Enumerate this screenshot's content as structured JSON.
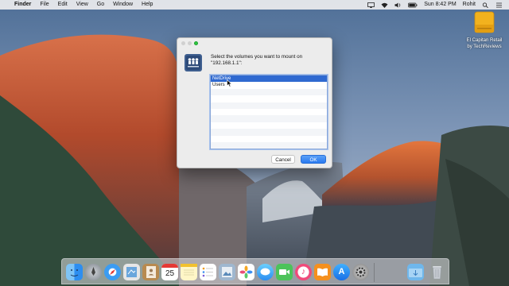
{
  "menubar": {
    "apple_glyph": "",
    "app_name": "Finder",
    "items": [
      "File",
      "Edit",
      "View",
      "Go",
      "Window",
      "Help"
    ],
    "clock": "Sun 8:42 PM",
    "user": "Rohit"
  },
  "desktop": {
    "drive_label_line1": "El Capitan Retail",
    "drive_label_line2": "by TechReviews"
  },
  "dialog": {
    "prompt_line1": "Select the volumes you want to mount on",
    "prompt_line2": "\"192.168.1.1\":",
    "volumes": [
      "NetDrive",
      "Users"
    ],
    "selected_volume": "NetDrive",
    "cancel_label": "Cancel",
    "ok_label": "OK"
  },
  "dock": {
    "calendar_day": "25",
    "items": [
      "Finder",
      "Launchpad",
      "Safari",
      "Mail",
      "Contacts",
      "Calendar",
      "Notes",
      "Reminders",
      "Preview",
      "Photos",
      "Messages",
      "FaceTime",
      "iTunes",
      "iBooks",
      "App Store",
      "System Preferences",
      "Downloads",
      "Trash"
    ]
  }
}
